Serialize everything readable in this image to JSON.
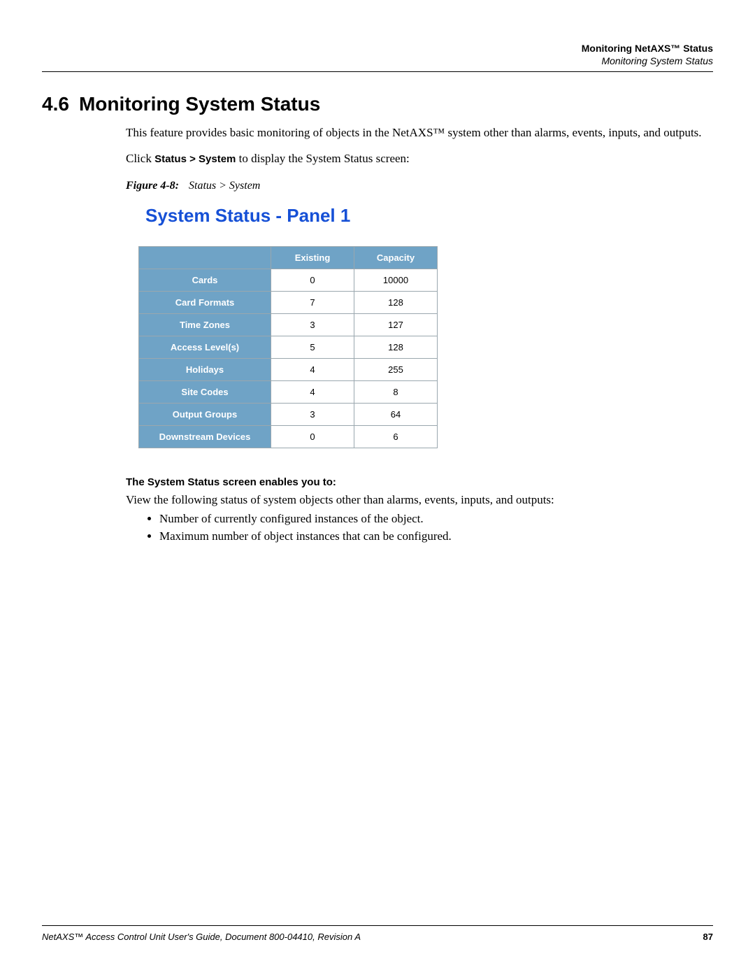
{
  "header": {
    "line1": "Monitoring NetAXS™ Status",
    "line2": "Monitoring System Status"
  },
  "section": {
    "number": "4.6",
    "title": "Monitoring System Status"
  },
  "intro_para": "This feature provides basic monitoring of objects in the NetAXS™ system other than alarms, events, inputs, and outputs.",
  "click_para_prefix": "Click ",
  "click_para_bold": "Status > System",
  "click_para_suffix": " to display the System Status screen:",
  "figure": {
    "label": "Figure 4-8:",
    "title": "Status > System"
  },
  "panel_heading": "System Status - Panel 1",
  "table": {
    "col1": "Existing",
    "col2": "Capacity",
    "rows": [
      {
        "label": "Cards",
        "existing": "0",
        "capacity": "10000"
      },
      {
        "label": "Card Formats",
        "existing": "7",
        "capacity": "128"
      },
      {
        "label": "Time Zones",
        "existing": "3",
        "capacity": "127"
      },
      {
        "label": "Access Level(s)",
        "existing": "5",
        "capacity": "128"
      },
      {
        "label": "Holidays",
        "existing": "4",
        "capacity": "255"
      },
      {
        "label": "Site Codes",
        "existing": "4",
        "capacity": "8"
      },
      {
        "label": "Output Groups",
        "existing": "3",
        "capacity": "64"
      },
      {
        "label": "Downstream Devices",
        "existing": "0",
        "capacity": "6"
      }
    ]
  },
  "enable_heading": "The System Status screen enables you to:",
  "view_para": "View the following status of system objects other than alarms, events, inputs, and outputs:",
  "bullets": [
    "Number of currently configured instances of the object.",
    "Maximum number of object instances that can be configured."
  ],
  "footer": {
    "left": "NetAXS™ Access Control Unit User's Guide, Document 800-04410, Revision A",
    "page": "87"
  }
}
